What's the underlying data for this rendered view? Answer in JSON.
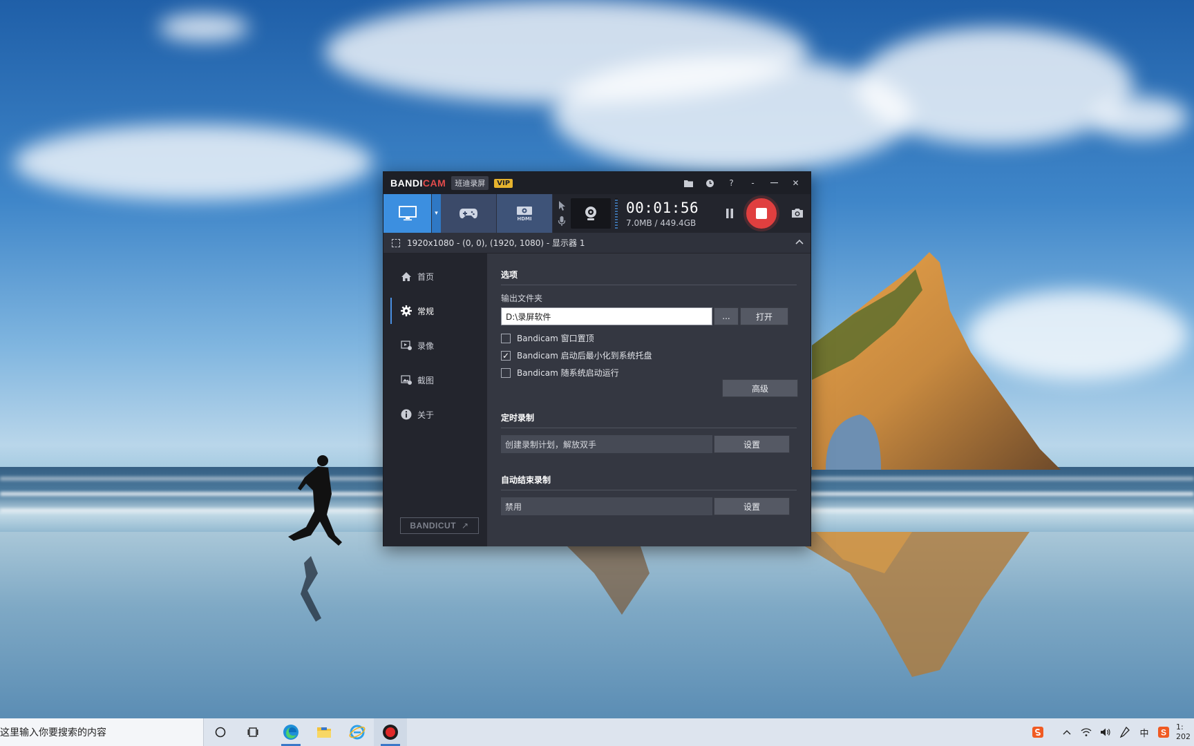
{
  "window": {
    "logo_part1": "BANDI",
    "logo_part2": "CAM",
    "cn_name": "班迪录屏",
    "vip": "VIP",
    "title_icons": [
      "folder-icon",
      "clock-icon",
      "help-icon",
      "minimize-tray-icon",
      "minimize-icon",
      "close-icon"
    ],
    "help_label": "?",
    "dash_label": "-",
    "close_label": "✕"
  },
  "toolbar": {
    "modes": [
      "screen-mode-icon",
      "game-mode-icon",
      "hdmi-mode-icon"
    ],
    "hdmi_label": "HDMI",
    "timer": "00:01:56",
    "size": "7.0MB / 449.4GB"
  },
  "area": {
    "text": "1920x1080 - (0, 0), (1920, 1080) - 显示器 1"
  },
  "sidebar": {
    "items": [
      {
        "label": "首页",
        "icon": "home-icon"
      },
      {
        "label": "常规",
        "icon": "gear-icon"
      },
      {
        "label": "录像",
        "icon": "video-settings-icon"
      },
      {
        "label": "截图",
        "icon": "image-settings-icon"
      },
      {
        "label": "关于",
        "icon": "info-icon"
      }
    ],
    "active": "常规",
    "bandicut_part1": "BANDI",
    "bandicut_part2": "CUT",
    "bandicut_arrow": "↗"
  },
  "content": {
    "options_title": "选项",
    "output_label": "输出文件夹",
    "output_value": "D:\\录屏软件",
    "browse_label": "...",
    "open_label": "打开",
    "checks": [
      {
        "label": "Bandicam 窗口置顶",
        "checked": false
      },
      {
        "label": "Bandicam 启动后最小化到系统托盘",
        "checked": true
      },
      {
        "label": "Bandicam 随系统启动运行",
        "checked": false
      }
    ],
    "advanced_label": "高级",
    "schedule_title": "定时录制",
    "schedule_value": "创建录制计划，解放双手",
    "schedule_button": "设置",
    "autostop_title": "自动结束录制",
    "autostop_value": "禁用",
    "autostop_button": "设置"
  },
  "taskbar": {
    "search_text": "在这里输入你要搜索的内容",
    "apps": [
      "cortana-icon",
      "task-view-icon",
      "edge-icon",
      "file-explorer-icon",
      "ie-icon",
      "bandicam-app-icon"
    ],
    "tray_icons": [
      "sogou-icon",
      "chevron-up-icon",
      "wifi-icon",
      "volume-icon",
      "pen-icon",
      "ime-icon",
      "sogou-s-icon"
    ],
    "ime_label": "中",
    "clock_time": "1:",
    "clock_date": "202"
  }
}
